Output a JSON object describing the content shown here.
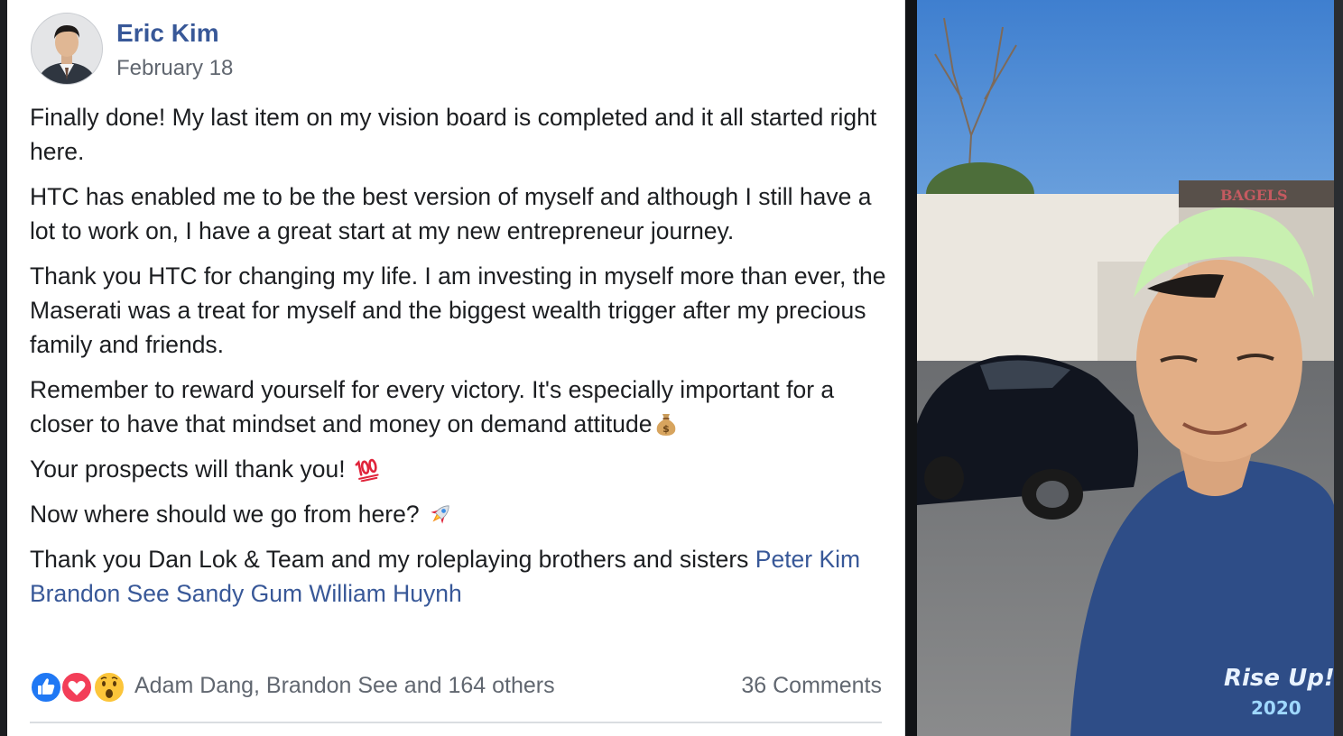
{
  "post": {
    "author": "Eric Kim",
    "date": "February 18",
    "paragraphs": [
      "Finally done! My last item on my vision board is completed and it all started right here.",
      "HTC has enabled me to be the best version of myself and although I still have a lot to work on, I have a great start at my new entrepreneur journey.",
      "Thank you HTC for changing my life. I am investing in myself more than ever, the Maserati was a treat for myself and the biggest wealth trigger after my precious family and friends.",
      "Remember to reward yourself for every victory. It's especially important for a closer to have that mindset and money on demand attitude",
      "Your prospects will thank you!",
      "Now where should we go from here?",
      "Thank you Dan Lok & Team and my roleplaying brothers and sisters"
    ],
    "emojis": [
      "money-bag-icon",
      "hundred-points-icon",
      "rocket-icon"
    ],
    "mentions": [
      "Peter Kim",
      "Brandon See",
      "Sandy Gum",
      "William Huynh"
    ]
  },
  "reactions": {
    "icons": [
      "like-icon",
      "love-icon",
      "wow-icon"
    ],
    "summary": "Adam Dang, Brandon See and 164 others",
    "comments": "36 Comments"
  },
  "photo": {
    "shirt_text": "Rise Up!",
    "shirt_year": "2020",
    "sign_text": "BAGELS"
  },
  "colors": {
    "link": "#385898",
    "text": "#1c1e21",
    "meta": "#616770",
    "like": "#2078f4",
    "love": "#f33e58",
    "wow": "#fcc53a"
  }
}
